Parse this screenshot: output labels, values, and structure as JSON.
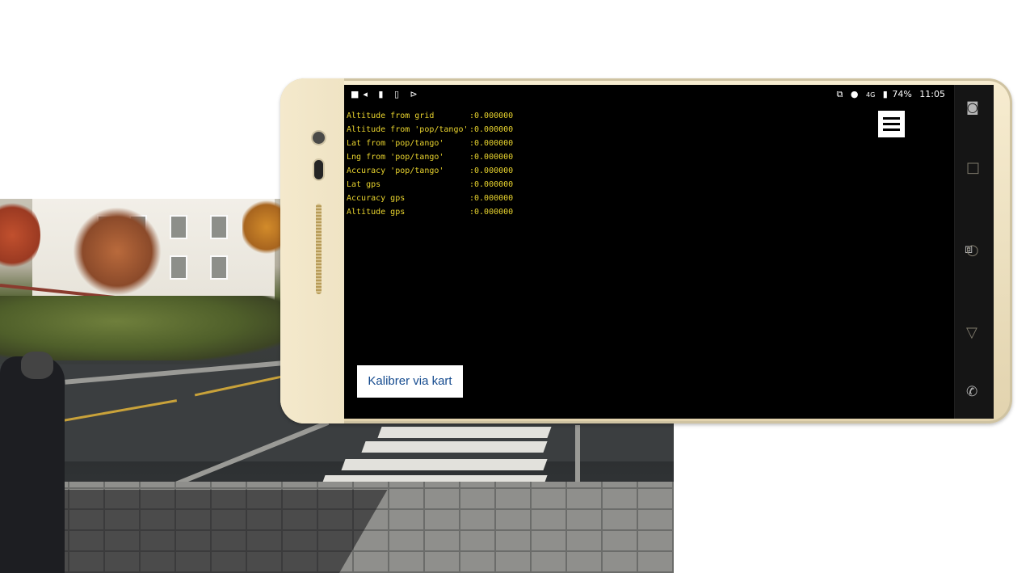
{
  "statusbar": {
    "left_icons": "■◂ ▮ ▯ ⊳",
    "cast_icon": "⧉",
    "location_icon": "●",
    "signal_label": "4G",
    "battery": "74%",
    "time": "11:05"
  },
  "readout": [
    {
      "label": "Altitude from grid",
      "value": ":0.000000"
    },
    {
      "label": "Altitude from 'pop/tango'",
      "value": ":0.000000"
    },
    {
      "label": "Lat from 'pop/tango'",
      "value": ":0.000000"
    },
    {
      "label": "Lng from 'pop/tango'",
      "value": ":0.000000"
    },
    {
      "label": "Accuracy 'pop/tango'",
      "value": ":0.000000"
    },
    {
      "label": "Lat gps",
      "value": ":0.000000"
    },
    {
      "label": "Accuracy gps",
      "value": ":0.000000"
    },
    {
      "label": "Altitude gps",
      "value": ":0.000000"
    }
  ],
  "buttons": {
    "calibrate": "Kalibrer via kart"
  },
  "icons": {
    "menu": "hamburger-menu-icon",
    "nav_square": "□",
    "nav_circle": "○",
    "nav_triangle": "▽"
  }
}
